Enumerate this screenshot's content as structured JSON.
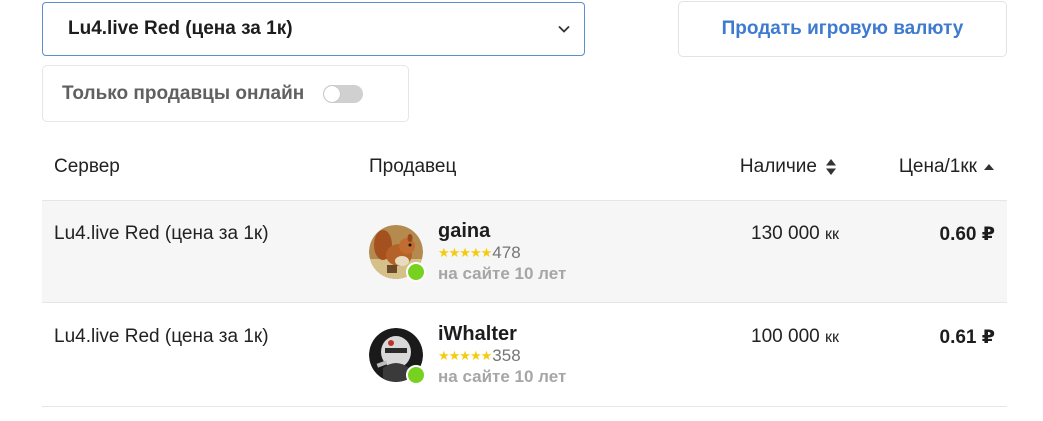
{
  "filters": {
    "game_select": {
      "selected": "Lu4.live Red (цена за 1к)"
    },
    "sell_button": "Продать игровую валюту",
    "online_only": {
      "label": "Только продавцы онлайн",
      "enabled": false
    }
  },
  "table": {
    "headers": {
      "server": "Сервер",
      "seller": "Продавец",
      "stock": "Наличие",
      "price": "Цена/1кк"
    },
    "rows": [
      {
        "server": "Lu4.live Red (цена за 1к)",
        "seller": {
          "name": "gaina",
          "stars": "★★★★★",
          "reviews": "478",
          "since": "на сайте 10 лет",
          "online": true,
          "avatar": "squirrel-avatar"
        },
        "stock": "130 000",
        "stock_unit": "кк",
        "price": "0.60 ₽"
      },
      {
        "server": "Lu4.live Red (цена за 1к)",
        "seller": {
          "name": "iWhalter",
          "stars": "★★★★★",
          "reviews": "358",
          "since": "на сайте 10 лет",
          "online": true,
          "avatar": "masked-figure-avatar"
        },
        "stock": "100 000",
        "stock_unit": "кк",
        "price": "0.61 ₽"
      }
    ]
  },
  "colors": {
    "accent": "#3e7bd0",
    "online": "#77d11f",
    "star": "#f5cb0d"
  }
}
